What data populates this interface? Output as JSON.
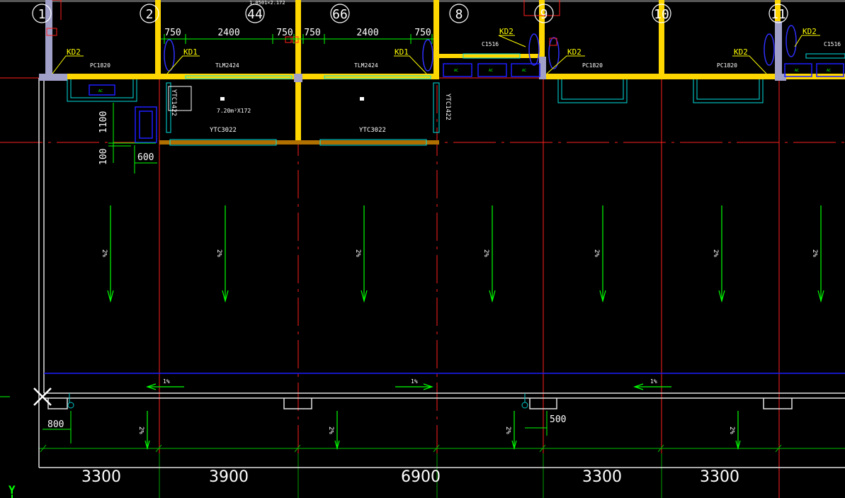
{
  "app": {
    "title": "CAD drawing canvas"
  },
  "colors": {
    "background": "#000000",
    "wall": "#ffd700",
    "axis": "#ff0000",
    "window": "#00ffff",
    "dim": "#00ff00",
    "annotation": "#ffff00",
    "blue": "#1e1eff"
  },
  "axis_labels": [
    "1",
    "2",
    "44",
    "66",
    "8",
    "9",
    "10",
    "11"
  ],
  "bottom_dims": [
    "3300",
    "3900",
    "6900",
    "3300",
    "3300"
  ],
  "top_dims": [
    "750",
    "2400",
    "750",
    "750",
    "2400",
    "750"
  ],
  "kd_labels": [
    "KD2",
    "KD1",
    "KD1",
    "KD2",
    "KD2",
    "KD2",
    "KD2"
  ],
  "window_labels": [
    "PC1820",
    "TLM2424",
    "TLM2424",
    "C1516",
    "PC1820",
    "PC1820",
    "C1516"
  ],
  "ytc_labels": [
    "YTC3022",
    "YTC3022"
  ],
  "ytc_vertical": [
    "YTC1422",
    "YTC1422"
  ],
  "room_text": [
    "7.20m²X172"
  ],
  "left_dims": [
    "1100",
    "100",
    "600",
    "800",
    "500"
  ],
  "slope_labels": [
    "1%",
    "1%",
    "1%"
  ],
  "arrow_labels": [
    "2%"
  ],
  "ac_label": "AC",
  "top_cut_text": "1.0501×2.172",
  "ucs": {
    "y": "Y"
  }
}
